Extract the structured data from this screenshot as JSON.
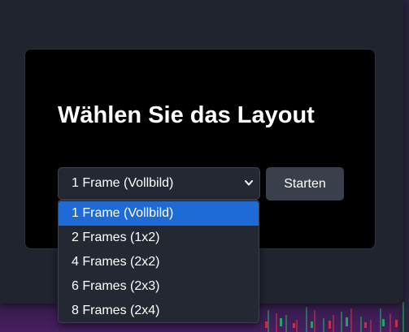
{
  "dialog": {
    "title": "Wählen Sie das Layout",
    "select_value": "1 Frame (Vollbild)",
    "start_label": "Starten"
  },
  "dropdown": {
    "options": [
      {
        "label": "1 Frame (Vollbild)",
        "selected": true
      },
      {
        "label": "2 Frames (1x2)",
        "selected": false
      },
      {
        "label": "4 Frames (2x2)",
        "selected": false
      },
      {
        "label": "6 Frames (2x3)",
        "selected": false
      },
      {
        "label": "8 Frames (2x4)",
        "selected": false
      }
    ]
  },
  "colors": {
    "accent": "#1f6bd6",
    "panel": "#20242f",
    "card": "#000000",
    "button": "#3a3f4c"
  },
  "icons": {
    "select_arrow": "chevron-down-icon"
  }
}
